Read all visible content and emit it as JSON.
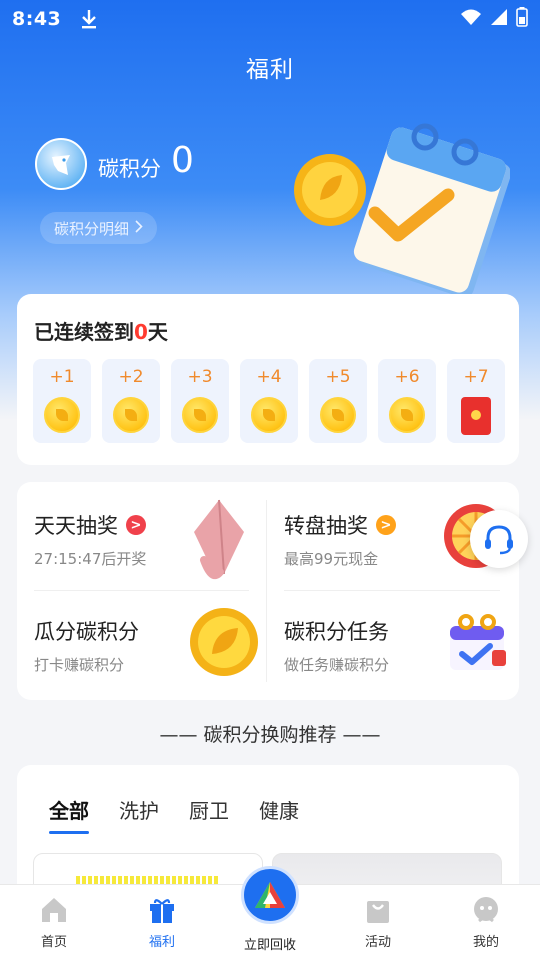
{
  "status_bar": {
    "time": "8:43"
  },
  "header": {
    "title": "福利"
  },
  "profile": {
    "carbon_label": "碳积分",
    "carbon_value": "0",
    "detail_link": "碳积分明细",
    "detail_chevron": ">"
  },
  "signin": {
    "title_prefix": "已连续签到",
    "days_count": "0",
    "title_suffix": "天",
    "days": [
      {
        "label": "+1",
        "reward": "coin-icon"
      },
      {
        "label": "+2",
        "reward": "coin-icon"
      },
      {
        "label": "+3",
        "reward": "coin-icon"
      },
      {
        "label": "+4",
        "reward": "coin-icon"
      },
      {
        "label": "+5",
        "reward": "coin-icon"
      },
      {
        "label": "+6",
        "reward": "coin-icon"
      },
      {
        "label": "+7",
        "reward": "red-packet-icon"
      }
    ]
  },
  "activities": {
    "daily_lottery": {
      "title": "天天抽奖",
      "sub": "27:15:47后开奖",
      "badge": ">"
    },
    "wheel_lottery": {
      "title": "转盘抽奖",
      "sub": "最高99元现金",
      "badge": ">"
    },
    "split_points": {
      "title": "瓜分碳积分",
      "sub": "打卡赚碳积分"
    },
    "point_tasks": {
      "title": "碳积分任务",
      "sub": "做任务赚碳积分"
    }
  },
  "recommend": {
    "header": "—— 碳积分换购推荐 ——",
    "tabs": [
      "全部",
      "洗护",
      "厨卫",
      "健康"
    ]
  },
  "bottom_nav": {
    "home": "首页",
    "welfare": "福利",
    "recycle": "立即回收",
    "activity": "活动",
    "mine": "我的"
  },
  "colors": {
    "primary": "#1e6ff0",
    "accent_red": "#ff3b30",
    "coin": "#ffc417"
  }
}
